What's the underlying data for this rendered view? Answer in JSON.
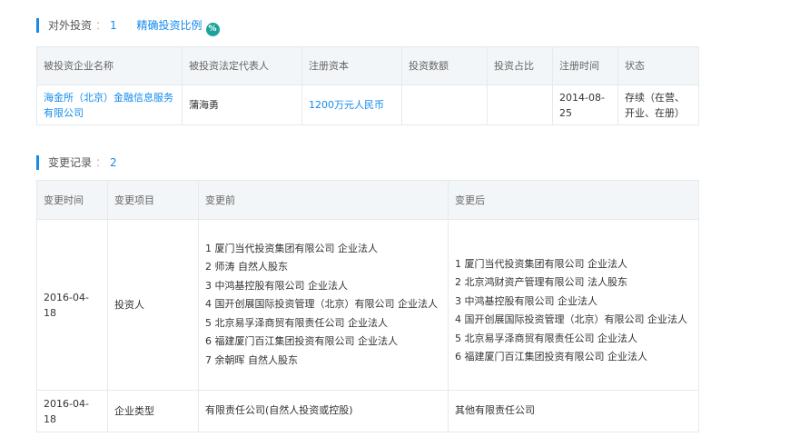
{
  "investment": {
    "title": "对外投资",
    "separator": "：",
    "count": "1",
    "ratio_link": "精确投资比例",
    "ratio_icon": "%",
    "headers": [
      "被投资企业名称",
      "被投资法定代表人",
      "注册资本",
      "投资数额",
      "投资占比",
      "注册时间",
      "状态"
    ],
    "rows": [
      {
        "company": "海金所（北京）金融信息服务有限公司",
        "legal_rep": "蒲海勇",
        "capital": "1200万元人民币",
        "amount": "",
        "ratio": "",
        "reg_date": "2014-08-25",
        "status": "存续（在营、开业、在册）"
      }
    ]
  },
  "changes": {
    "title": "变更记录",
    "separator": "：",
    "count": "2",
    "headers": [
      "变更时间",
      "变更项目",
      "变更前",
      "变更后"
    ],
    "rows": [
      {
        "date": "2016-04-18",
        "item": "投资人",
        "before": [
          "1 厦门当代投资集团有限公司 企业法人",
          "2 师涛 自然人股东",
          "3 中鸿基控股有限公司 企业法人",
          "4 国开创展国际投资管理（北京）有限公司 企业法人",
          "5 北京易孚泽商贸有限责任公司 企业法人",
          "6 福建厦门百江集团投资有限公司 企业法人",
          "7 余朝晖 自然人股东"
        ],
        "after": [
          "1 厦门当代投资集团有限公司 企业法人",
          "2 北京鸿财资产管理有限公司 法人股东",
          "3 中鸿基控股有限公司 企业法人",
          "4 国开创展国际投资管理（北京）有限公司 企业法人",
          "5 北京易孚泽商贸有限责任公司 企业法人",
          "6 福建厦门百江集团投资有限公司 企业法人"
        ]
      },
      {
        "date": "2016-04-18",
        "item": "企业类型",
        "before": [
          "有限责任公司(自然人投资或控股)"
        ],
        "after": [
          "其他有限责任公司"
        ]
      }
    ]
  }
}
